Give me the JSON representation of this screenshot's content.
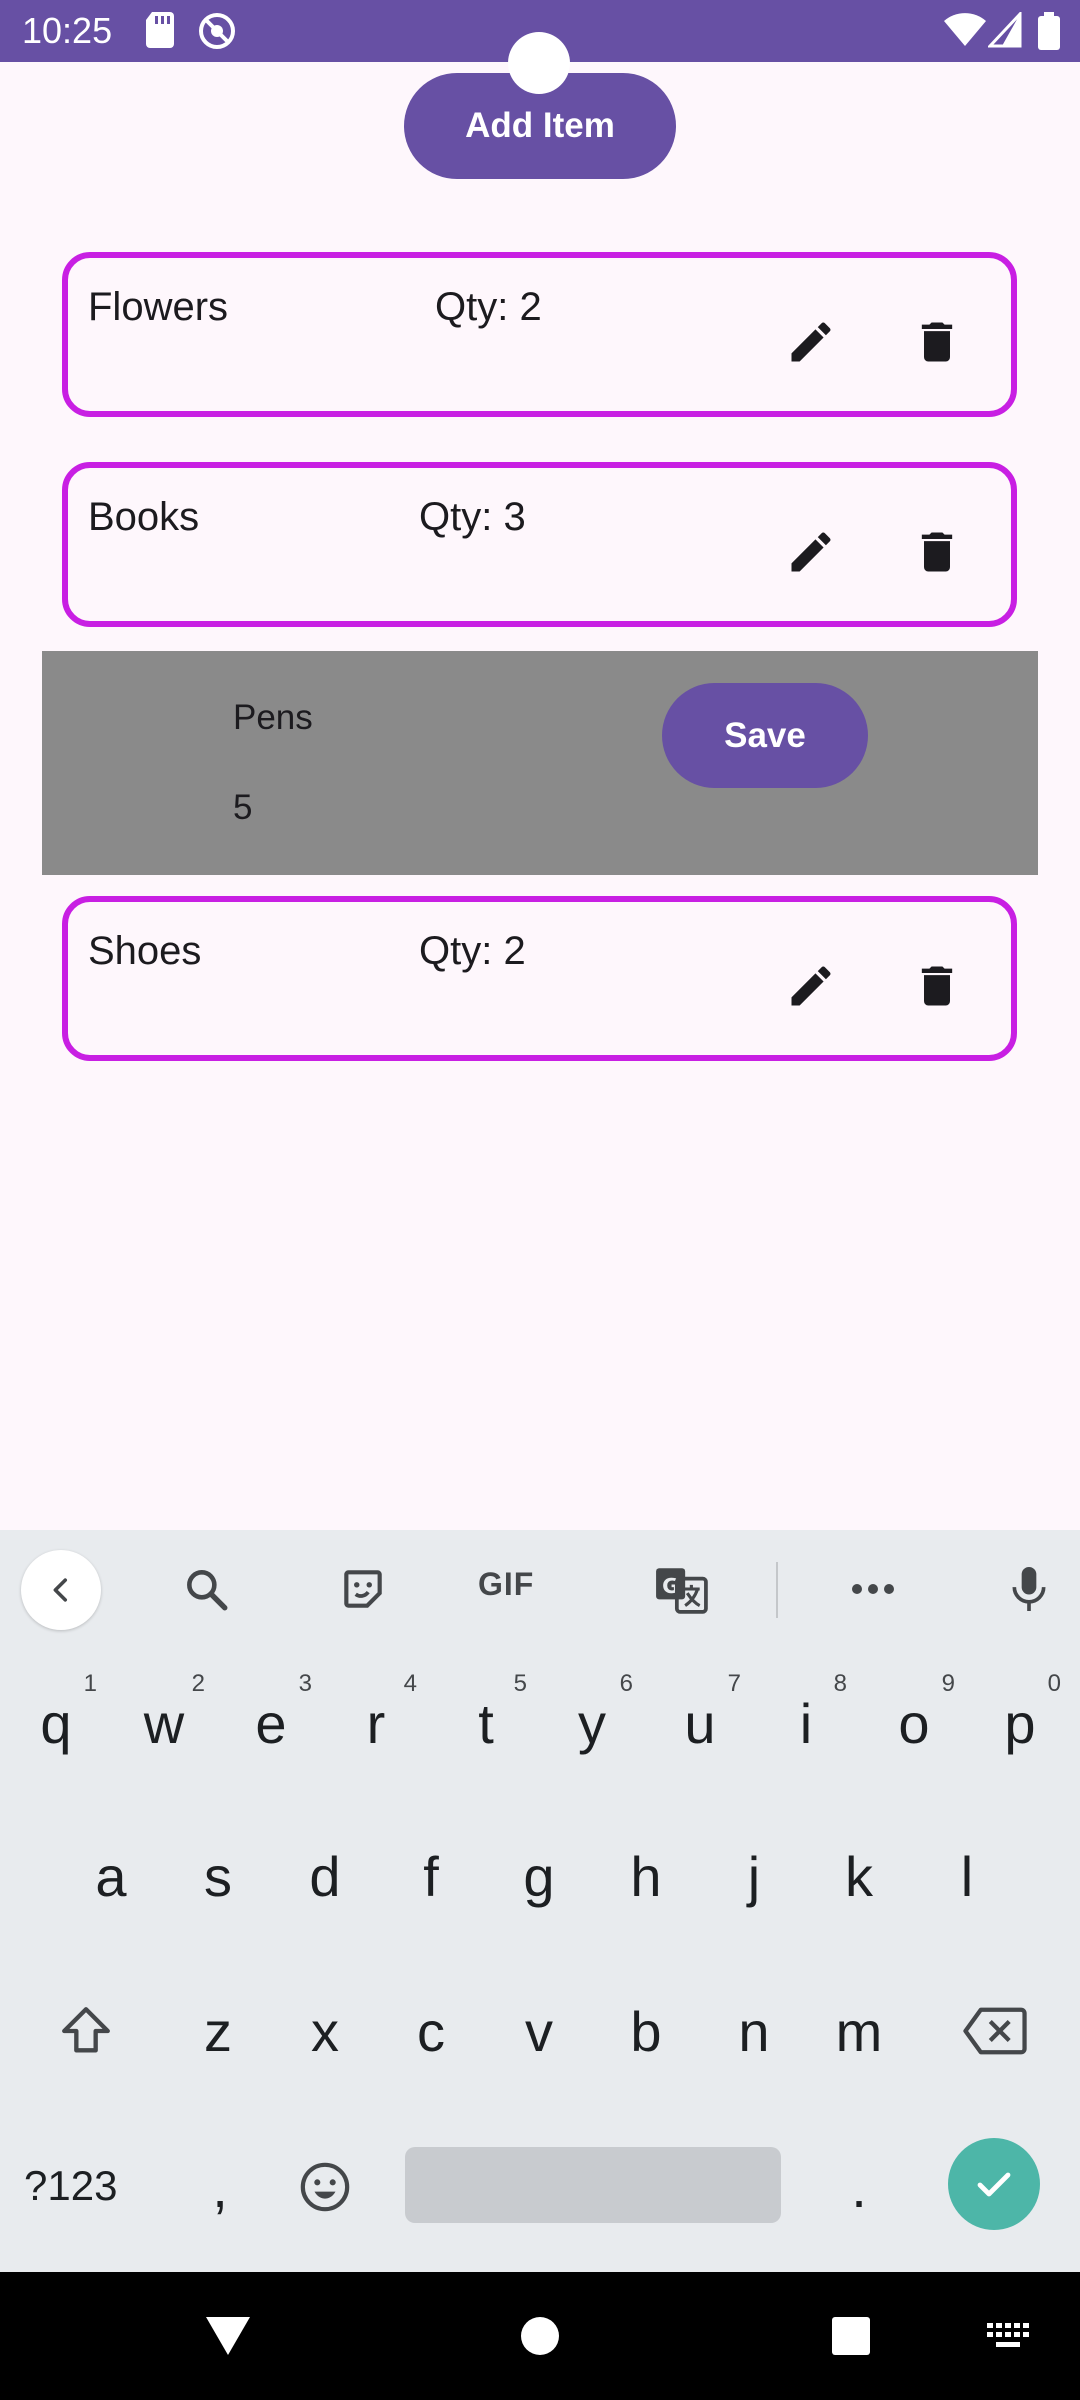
{
  "status_bar": {
    "time": "10:25",
    "left_icons": [
      "sd-card-icon",
      "dnd-icon"
    ],
    "right_icons": [
      "wifi-icon",
      "signal-icon",
      "battery-icon"
    ],
    "color": "#6750a4"
  },
  "header": {
    "add_label": "Add Item"
  },
  "items": [
    {
      "name": "Flowers",
      "qty_text": "Qty: 2"
    },
    {
      "name": "Books",
      "qty_text": "Qty: 3"
    },
    {
      "name": "Shoes",
      "qty_text": "Qty: 2"
    }
  ],
  "edit_panel": {
    "name_value": "Pens",
    "qty_value": "5",
    "save_label": "Save"
  },
  "keyboard": {
    "toolbar_icons": [
      "back-icon",
      "search-icon",
      "sticker-icon",
      "gif-icon",
      "translate-icon",
      "more-icon",
      "mic-icon"
    ],
    "gif_label": "GIF",
    "row1": [
      "q",
      "w",
      "e",
      "r",
      "t",
      "y",
      "u",
      "i",
      "o",
      "p"
    ],
    "row1_hints": [
      "1",
      "2",
      "3",
      "4",
      "5",
      "6",
      "7",
      "8",
      "9",
      "0"
    ],
    "row2": [
      "a",
      "s",
      "d",
      "f",
      "g",
      "h",
      "j",
      "k",
      "l"
    ],
    "row3": [
      "z",
      "x",
      "c",
      "v",
      "b",
      "n",
      "m"
    ],
    "sym_label": "?123",
    "comma": ",",
    "period": "."
  },
  "colors": {
    "accent": "#6750a4",
    "card_border": "#c81fe3",
    "panel": "#8a8a8a",
    "enter": "#4db6a8"
  }
}
